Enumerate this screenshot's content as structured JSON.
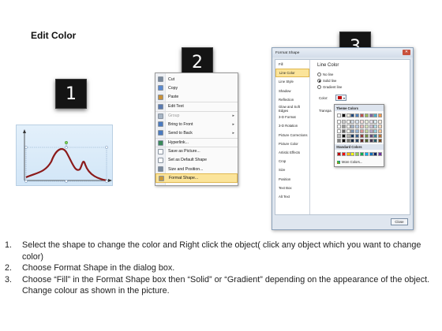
{
  "title": "Edit Color",
  "badges": [
    "1",
    "2",
    "3"
  ],
  "context_menu": {
    "items": [
      {
        "label": "Cut",
        "disabled": false,
        "icon": "scissors-icon",
        "color": "#7a8a9c"
      },
      {
        "label": "Copy",
        "disabled": false,
        "icon": "copy-icon",
        "color": "#5a8ad0"
      },
      {
        "label": "Paste",
        "disabled": false,
        "icon": "paste-icon",
        "color": "#c8913a"
      },
      {
        "label": "Edit Text",
        "disabled": false,
        "icon": "edit-text-icon",
        "color": "#5a7ab0"
      },
      {
        "label": "Group",
        "disabled": true,
        "icon": "group-icon",
        "color": "#a6b4c4",
        "submenu": true
      },
      {
        "label": "Bring to Front",
        "disabled": false,
        "icon": "bring-to-front-icon",
        "color": "#4a7ac0",
        "submenu": true
      },
      {
        "label": "Send to Back",
        "disabled": false,
        "icon": "send-to-back-icon",
        "color": "#4a7ac0",
        "submenu": true
      },
      {
        "label": "Hyperlink...",
        "disabled": false,
        "icon": "globe-icon",
        "color": "#3a8a5a"
      },
      {
        "label": "Save as Picture...",
        "disabled": false,
        "icon": "picture-icon",
        "color": "#ffffff"
      },
      {
        "label": "Set as Default Shape",
        "disabled": false,
        "icon": "default-shape-icon",
        "color": "#ffffff"
      },
      {
        "label": "Size and Position...",
        "disabled": false,
        "icon": "size-icon",
        "color": "#7a8a9c"
      },
      {
        "label": "Format Shape...",
        "disabled": false,
        "icon": "format-shape-icon",
        "color": "#c89a3a",
        "selected": true
      }
    ]
  },
  "dialog": {
    "title": "Format Shape",
    "close_label": "Close",
    "categories": [
      "Fill",
      "Line Color",
      "Line Style",
      "Shadow",
      "Reflection",
      "Glow and Soft Edges",
      "3-D Format",
      "3-D Rotation",
      "Picture Corrections",
      "Picture Color",
      "Artistic Effects",
      "Crop",
      "Size",
      "Position",
      "Text Box",
      "Alt Text"
    ],
    "selected_category": "Line Color",
    "panel_title": "Line Color",
    "options": [
      {
        "label": "No line",
        "checked": false
      },
      {
        "label": "Solid line",
        "checked": true
      },
      {
        "label": "Gradient line",
        "checked": false
      }
    ],
    "color_label": "Color:",
    "transparency_label": "Transpa",
    "palette": {
      "theme_header": "Theme Colors",
      "standard_header": "Standard Colors",
      "more_label": "More Colors...",
      "theme_top": [
        "#ffffff",
        "#000000",
        "#eeece1",
        "#1f497d",
        "#4f81bd",
        "#c0504d",
        "#9bbb59",
        "#8064a2",
        "#4bacc6",
        "#f79646"
      ],
      "standard": [
        "#c00000",
        "#ff0000",
        "#ffc000",
        "#ffff00",
        "#92d050",
        "#00b050",
        "#00b0f0",
        "#0070c0",
        "#002060",
        "#7030a0"
      ]
    }
  },
  "instructions": [
    {
      "num": "1.",
      "text": "Select the shape to change the color and Right click the object( click any object which you want to change color)"
    },
    {
      "num": "2.",
      "text": "Choose Format Shape in the dialog box."
    },
    {
      "num": "3.",
      "text": "Choose “Fill” in the Format Shape box then “Solid” or “Gradient” depending on the appearance of the object. Change colour as shown in the picture."
    }
  ]
}
